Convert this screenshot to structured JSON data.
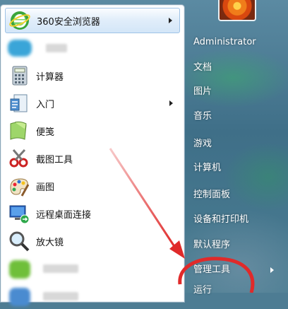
{
  "colors": {
    "annotation_red": "#e02a2a",
    "highlight_border": "#9fc3e6",
    "right_text": "#ffffff"
  },
  "programs": [
    {
      "label": "360安全浏览器",
      "icon": "browser-360-icon",
      "has_submenu": true
    },
    {
      "label": "",
      "icon": "blurred-app-icon",
      "has_submenu": false,
      "blurred": true
    },
    {
      "label": "计算器",
      "icon": "calculator-icon",
      "has_submenu": false
    },
    {
      "label": "入门",
      "icon": "getting-started-icon",
      "has_submenu": true
    },
    {
      "label": "便笺",
      "icon": "sticky-notes-icon",
      "has_submenu": false
    },
    {
      "label": "截图工具",
      "icon": "snipping-tool-icon",
      "has_submenu": false
    },
    {
      "label": "画图",
      "icon": "paint-icon",
      "has_submenu": false
    },
    {
      "label": "远程桌面连接",
      "icon": "remote-desktop-icon",
      "has_submenu": false
    },
    {
      "label": "放大镜",
      "icon": "magnifier-icon",
      "has_submenu": false
    }
  ],
  "right_items": [
    {
      "label": "Administrator"
    },
    {
      "label": "文档"
    },
    {
      "label": "图片"
    },
    {
      "label": "音乐"
    },
    {
      "label": "游戏"
    },
    {
      "label": "计算机"
    },
    {
      "label": "控制面板"
    },
    {
      "label": "设备和打印机"
    },
    {
      "label": "默认程序"
    },
    {
      "label": "管理工具",
      "has_submenu": true
    },
    {
      "label": "运行"
    }
  ]
}
